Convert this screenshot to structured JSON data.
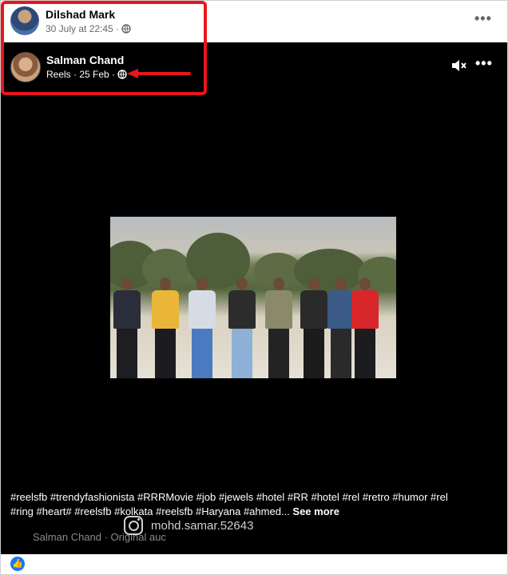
{
  "post": {
    "sharer": {
      "name": "Dilshad Mark",
      "time": "30 July at 22:45 ·",
      "privacy_icon": "globe-icon"
    },
    "original": {
      "name": "Salman Chand",
      "meta": "Reels · 25 Feb ·",
      "privacy_icon": "globe-icon"
    },
    "more_label": "•••",
    "caption": "#reelsfb #trendyfashionista #RRRMovie #job #jewels #hotel #RR #hotel #rel #retro #humor #rel #ring #heart# #reelsfb #kolkata #reelsfb #Haryana #ahmed...",
    "see_more": "See more",
    "watermark": "mohd.samar.52643",
    "audio": "Salman Chand · Original auc"
  },
  "colors": {
    "highlight": "#e8161b",
    "like": "#1877f2"
  }
}
